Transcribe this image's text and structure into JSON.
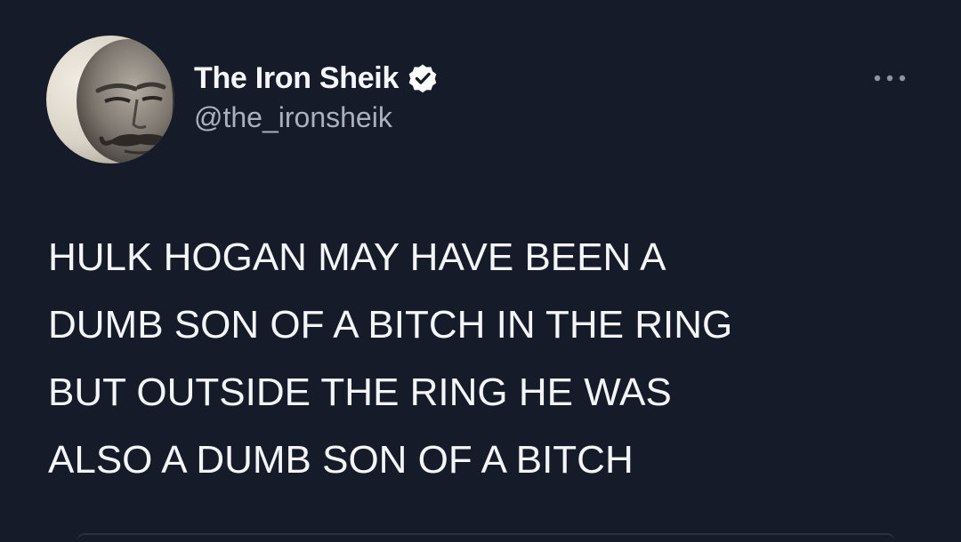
{
  "tweet": {
    "author": {
      "display_name": "The Iron Sheik",
      "handle": "@the_ironsheik",
      "verified": true,
      "avatar_icon": "profile-photo"
    },
    "more_icon": "more-options-icon",
    "body_lines": [
      "HULK HOGAN MAY HAVE BEEN A",
      "DUMB SON OF A BITCH IN THE RING",
      "BUT OUTSIDE THE RING HE WAS",
      "ALSO A DUMB SON OF A BITCH"
    ]
  },
  "colors": {
    "background": "#151b28",
    "text_primary": "#f3f5f8",
    "text_secondary": "#a9b1bc",
    "verified_badge": "#ffffff"
  }
}
